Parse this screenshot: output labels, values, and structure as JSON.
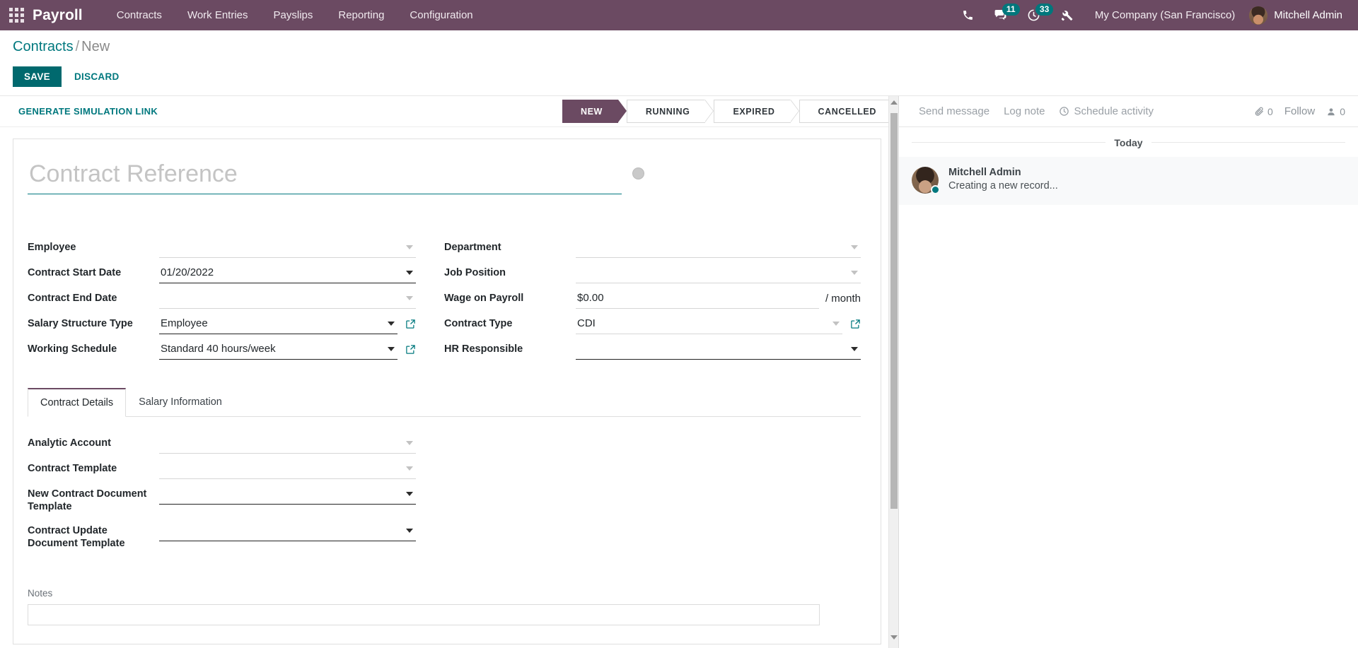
{
  "navbar": {
    "apps_icon": "apps-grid-icon",
    "brand": "Payroll",
    "menu": [
      {
        "label": "Contracts"
      },
      {
        "label": "Work Entries"
      },
      {
        "label": "Payslips"
      },
      {
        "label": "Reporting"
      },
      {
        "label": "Configuration"
      }
    ],
    "icons": {
      "phone": "phone-icon",
      "messages": {
        "icon": "chat-icon",
        "count": "11"
      },
      "activities": {
        "icon": "clock-icon",
        "count": "33"
      },
      "tools": "wrench-icon"
    },
    "company": "My Company (San Francisco)",
    "user": "Mitchell Admin",
    "accent": "#6b4a62",
    "badge_color": "#00777c"
  },
  "control_panel": {
    "breadcrumb_root": "Contracts",
    "breadcrumb_sep": "/",
    "breadcrumb_current": "New",
    "save_label": "SAVE",
    "discard_label": "DISCARD",
    "save_color": "#00696e",
    "link_color": "#00787e"
  },
  "statusbar": {
    "generate_link_label": "GENERATE SIMULATION LINK",
    "stages": [
      {
        "label": "NEW",
        "active": true
      },
      {
        "label": "RUNNING",
        "active": false
      },
      {
        "label": "EXPIRED",
        "active": false
      },
      {
        "label": "CANCELLED",
        "active": false
      }
    ]
  },
  "form": {
    "title_placeholder": "Contract Reference",
    "title_value": "",
    "left_fields": [
      {
        "label": "Employee",
        "value": "",
        "caret": "light",
        "filled": false
      },
      {
        "label": "Contract Start Date",
        "value": "01/20/2022",
        "caret": "dark",
        "filled": true
      },
      {
        "label": "Contract End Date",
        "value": "",
        "caret": "light",
        "filled": false
      },
      {
        "label": "Salary Structure Type",
        "value": "Employee",
        "caret": "dark",
        "filled": true,
        "external_link": true
      },
      {
        "label": "Working Schedule",
        "value": "Standard 40 hours/week",
        "caret": "dark",
        "filled": true,
        "external_link": true
      }
    ],
    "right_fields": [
      {
        "label": "Department",
        "value": "",
        "caret": "light",
        "filled": false
      },
      {
        "label": "Job Position",
        "value": "",
        "caret": "light",
        "filled": false
      },
      {
        "label": "Wage on Payroll",
        "value": "$0.00",
        "suffix": "/ month",
        "caret": "none",
        "filled": false
      },
      {
        "label": "Contract Type",
        "value": "CDI",
        "caret": "light",
        "filled": false,
        "external_link": true
      },
      {
        "label": "HR Responsible",
        "value": "",
        "caret": "dark",
        "filled": true
      }
    ],
    "tabs": [
      {
        "label": "Contract Details",
        "active": true
      },
      {
        "label": "Salary Information",
        "active": false
      }
    ],
    "tab_fields": [
      {
        "label": "Analytic Account",
        "value": "",
        "caret": "light",
        "filled": false
      },
      {
        "label": "Contract Template",
        "value": "",
        "caret": "light",
        "filled": false
      },
      {
        "label": "New Contract Document Template",
        "value": "",
        "caret": "dark",
        "filled": true
      },
      {
        "label": "Contract Update Document Template",
        "value": "",
        "caret": "dark",
        "filled": true
      }
    ],
    "notes_label": "Notes"
  },
  "chatter": {
    "send_message": "Send message",
    "log_note": "Log note",
    "schedule_activity": "Schedule activity",
    "attachment_count": "0",
    "follow_label": "Follow",
    "follower_count": "0",
    "day_separator": "Today",
    "messages": [
      {
        "author": "Mitchell Admin",
        "text": "Creating a new record..."
      }
    ]
  }
}
